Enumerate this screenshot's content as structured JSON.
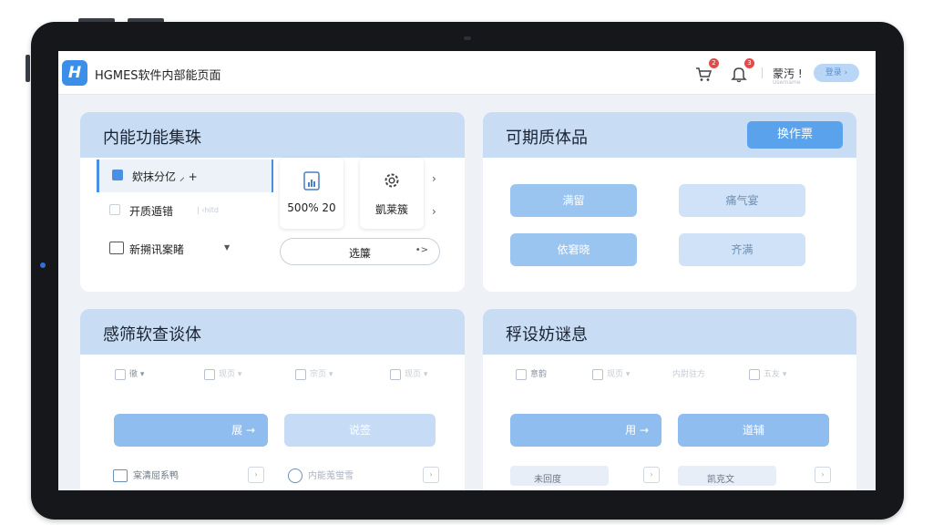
{
  "app": {
    "logo_letter": "H",
    "title": "HGMES软件内部能页面"
  },
  "header": {
    "cart_badge": "2",
    "bell_badge": "3",
    "user_name": "蒙汚 !",
    "user_sub": "Username",
    "pill_label": "登录 ›"
  },
  "panel1": {
    "title": "内能功能集珠",
    "items": [
      {
        "label": "欸抹分亿 ⸝ +"
      },
      {
        "label": "开质遁错",
        "faint": "| ‹hitd"
      },
      {
        "label": "新搠讯案睹",
        "caret": "▼"
      }
    ],
    "tiles": [
      {
        "label": "500% 20",
        "icon": "chart-doc-icon"
      },
      {
        "label": "凱莱簇",
        "icon": "gear-icon"
      }
    ],
    "chevron": "›",
    "outline_button": {
      "label": "选簾",
      "arrow": "•>"
    }
  },
  "panel2": {
    "title": "可期质体品",
    "header_button": "换作票",
    "buttons": [
      {
        "label": "满留",
        "style": "blue"
      },
      {
        "label": "痛气宴",
        "style": "pale"
      },
      {
        "label": "依窘晓",
        "style": "blue"
      },
      {
        "label": "齐满",
        "style": "pale"
      }
    ]
  },
  "panel3": {
    "title": "感筛软查谈体",
    "toolbar": [
      "徹 ▾",
      "现页 ▾",
      "宗页 ▾",
      "现页 ▾"
    ],
    "primary_button": "展 →",
    "secondary_button": "说签",
    "bottom_items": [
      "宲清屈系鸭",
      "内能蒐蛍雪"
    ]
  },
  "panel4": {
    "title": "稃设妨谜息",
    "toolbar": [
      "意韵",
      "现页 ▾",
      "内尉驻方",
      "五友 ▾"
    ],
    "primary_button": "用 →",
    "secondary_button": "道辅",
    "bottom_items": [
      "未回度",
      "凯克文"
    ]
  },
  "colors": {
    "accent": "#4a90e2",
    "panel_header": "#c8ddf4",
    "badge": "#e34b4b"
  }
}
